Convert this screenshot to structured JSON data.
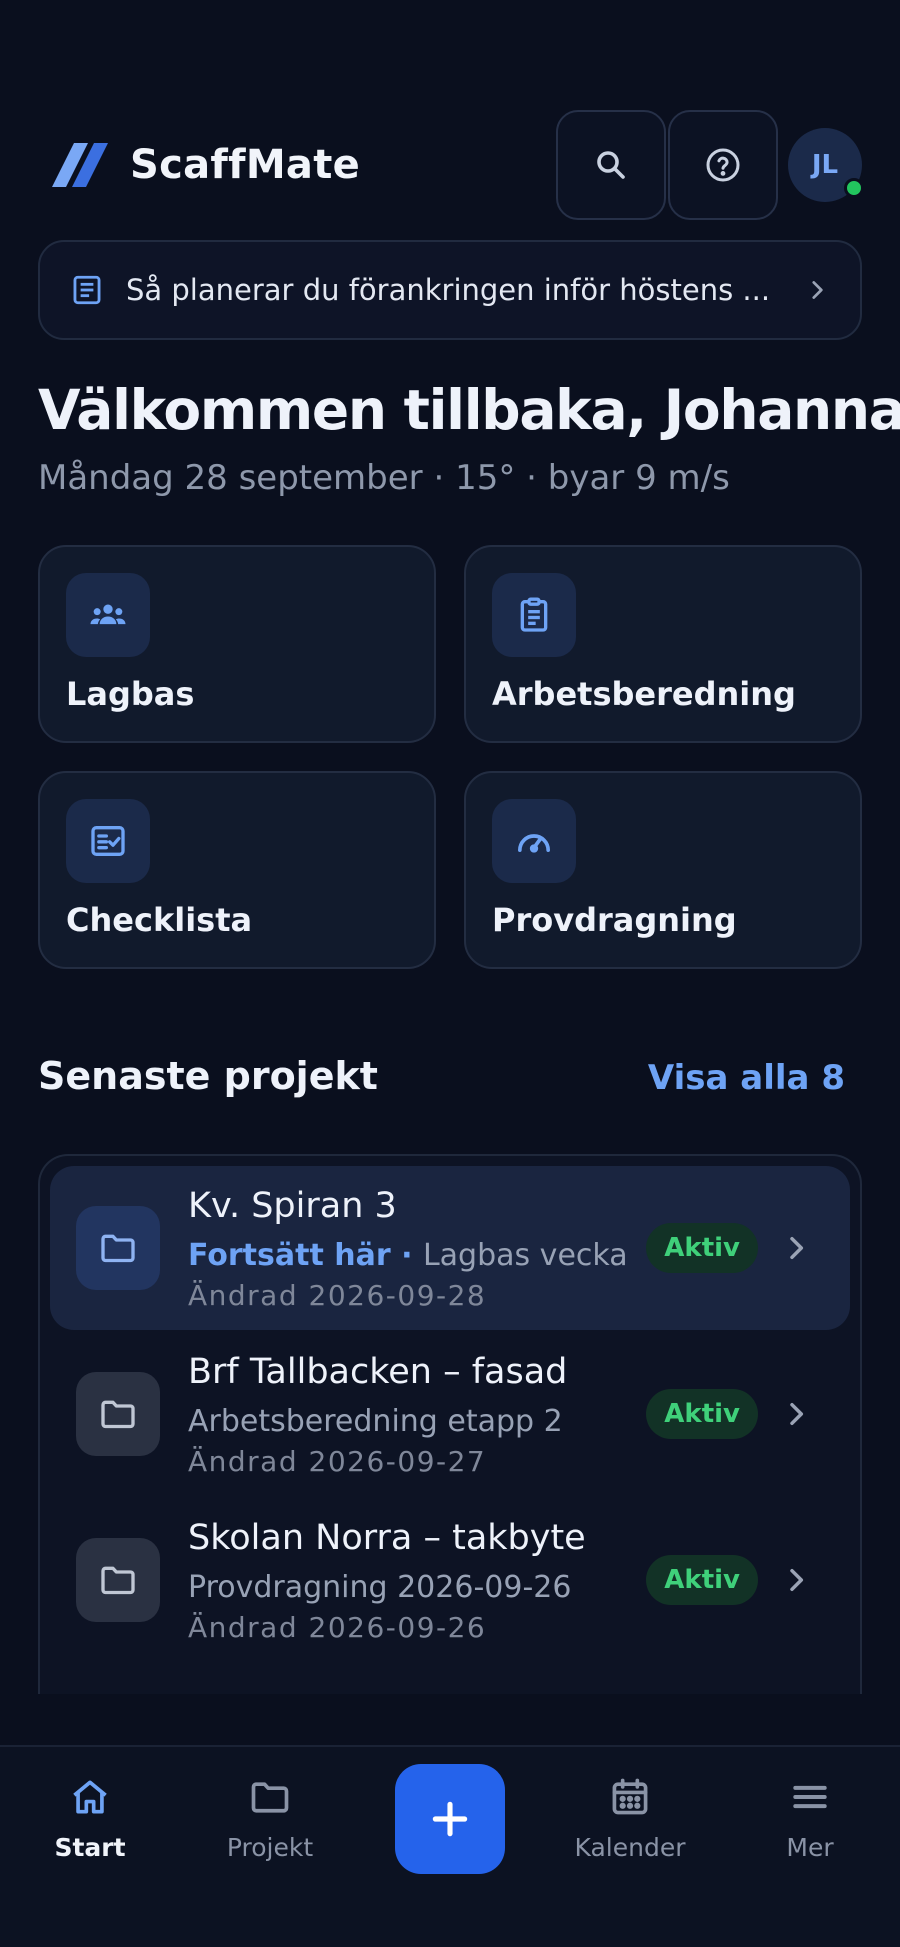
{
  "app": {
    "brand": "ScaffMate",
    "accent": "#2563eb",
    "link_color": "#6ea3f5"
  },
  "header": {
    "search_icon": "search-icon",
    "help_icon": "help-icon",
    "avatar_initials": "JL",
    "online_status_color": "#22c55e"
  },
  "announcement": {
    "icon": "document-icon",
    "text": "Så planerar du förankringen inför höstens ..."
  },
  "welcome": {
    "title": "Välkommen tillbaka, Johanna",
    "subtitle": "Måndag 28 september · 15° · byar 9 m/s"
  },
  "quick_actions": [
    {
      "label": "Lagbas",
      "icon": "team-icon"
    },
    {
      "label": "Arbetsberedning",
      "icon": "clipboard-icon"
    },
    {
      "label": "Checklista",
      "icon": "checklist-icon"
    },
    {
      "label": "Provdragning",
      "icon": "gauge-icon"
    }
  ],
  "recent": {
    "title": "Senaste projekt",
    "view_all": "Visa alla 8",
    "projects": [
      {
        "name": "Kv. Spiran 3",
        "continue_label": "Fortsätt här",
        "separator": " · ",
        "subtitle": "Lagbas vecka ...",
        "modified": "Ändrad 2026-09-28",
        "status": "Aktiv"
      },
      {
        "name": "Brf Tallbacken – fasad",
        "subtitle": "Arbetsberedning etapp 2",
        "modified": "Ändrad 2026-09-27",
        "status": "Aktiv"
      },
      {
        "name": "Skolan Norra – takbyte",
        "subtitle": "Provdragning 2026-09-26",
        "modified": "Ändrad 2026-09-26",
        "status": "Aktiv"
      }
    ]
  },
  "tabbar": {
    "tabs": [
      {
        "label": "Start",
        "icon": "home-icon",
        "selected": true
      },
      {
        "label": "Projekt",
        "icon": "folder-icon"
      },
      {
        "label": "Kalender",
        "icon": "calendar-icon"
      },
      {
        "label": "Mer",
        "icon": "menu-icon"
      }
    ],
    "fab_icon": "plus-icon"
  }
}
